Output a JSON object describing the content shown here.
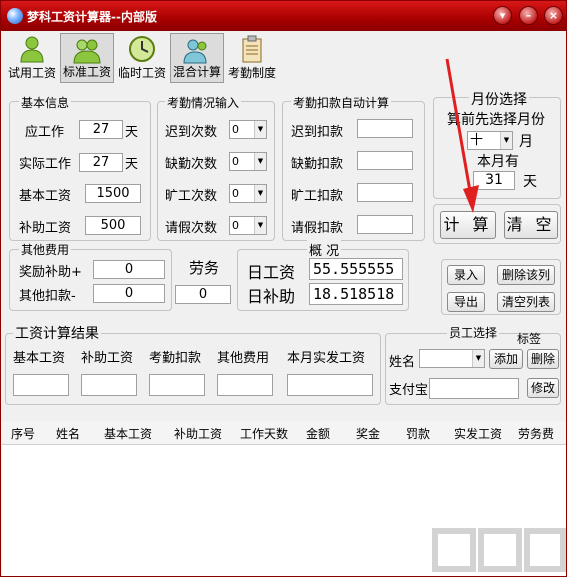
{
  "window": {
    "title": "梦科工资计算器--内部版"
  },
  "toolbar": {
    "items": [
      {
        "label": "试用工资",
        "icon": "person-icon"
      },
      {
        "label": "标准工资",
        "icon": "people-icon"
      },
      {
        "label": "临时工资",
        "icon": "clock-icon"
      },
      {
        "label": "混合计算",
        "icon": "group-icon"
      },
      {
        "label": "考勤制度",
        "icon": "clipboard-icon"
      }
    ]
  },
  "basic": {
    "title": "基本信息",
    "should_work_label": "应工作",
    "should_work": "27",
    "should_work_unit": "天",
    "actual_work_label": "实际工作",
    "actual_work": "27",
    "actual_work_unit": "天",
    "base_salary_label": "基本工资",
    "base_salary": "1500",
    "subsidy_label": "补助工资",
    "subsidy": "500"
  },
  "attendance": {
    "title": "考勤情况输入",
    "late_label": "迟到次数",
    "late": "0",
    "absent_label": "缺勤次数",
    "absent": "0",
    "truant_label": "旷工次数",
    "truant": "0",
    "leave_label": "请假次数",
    "leave": "0"
  },
  "deduct": {
    "title": "考勤扣款自动计算",
    "late_label": "迟到扣款",
    "absent_label": "缺勤扣款",
    "truant_label": "旷工扣款",
    "leave_label": "请假扣款"
  },
  "month": {
    "title": "月份选择",
    "hint": "算前先选择月份",
    "value": "十",
    "unit": "月",
    "days_label": "本月有",
    "days": "31",
    "days_unit": "天"
  },
  "buttons": {
    "calc": "计 算",
    "clear": "清 空",
    "entry": "录入",
    "delete_row": "删除该列",
    "export": "导出",
    "clear_list": "清空列表",
    "add": "添加",
    "delete": "删除",
    "modify": "修改"
  },
  "other": {
    "title": "其他费用",
    "bonus_label": "奖励补助+",
    "bonus": "0",
    "deduct_label": "其他扣款-",
    "deduct": "0",
    "labor_label": "劳务",
    "labor": "0"
  },
  "overview": {
    "title": "概 况",
    "daily_label": "日工资",
    "daily": "55.555555",
    "daily_sub_label": "日补助",
    "daily_sub": "18.518518"
  },
  "result": {
    "title": "工资计算结果",
    "cols": [
      "基本工资",
      "补助工资",
      "考勤扣款",
      "其他费用",
      "本月实发工资"
    ]
  },
  "staff": {
    "title": "员工选择",
    "tag_label": "标签",
    "name_label": "姓名",
    "alipay_label": "支付宝"
  },
  "table": {
    "headers": [
      "序号",
      "姓名",
      "基本工资",
      "补助工资",
      "工作天数",
      "金额",
      "奖金",
      "罚款",
      "实发工资",
      "劳务费"
    ]
  }
}
